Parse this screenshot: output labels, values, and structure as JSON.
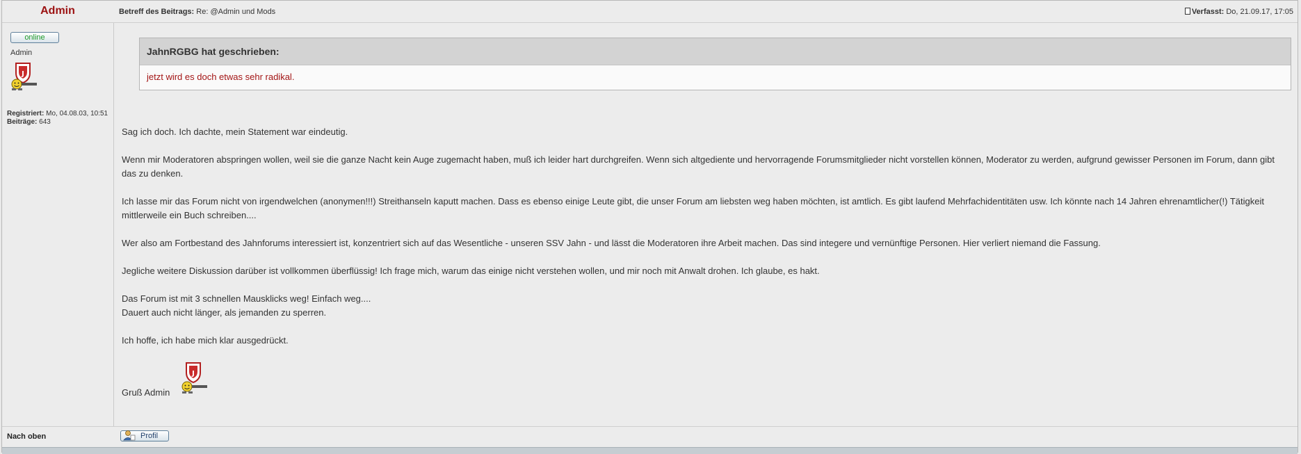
{
  "post": {
    "author": "Admin",
    "subject_label": "Betreff des Beitrags:",
    "subject": "Re: @Admin und Mods",
    "posted_label": "Verfasst:",
    "posted_time": "Do, 21.09.17, 17:05"
  },
  "profile": {
    "status": "online",
    "rank": "Admin",
    "registered_label": "Registriert:",
    "registered_value": "Mo, 04.08.03, 10:51",
    "posts_label": "Beiträge:",
    "posts_value": "643"
  },
  "quote": {
    "header": "JahnRGBG hat geschrieben:",
    "text": "jetzt wird es doch etwas sehr radikal."
  },
  "body": {
    "p1": "Sag ich doch. Ich dachte, mein Statement war eindeutig.",
    "p2": "Wenn mir Moderatoren abspringen wollen, weil sie die ganze Nacht kein Auge zugemacht haben, muß ich leider hart durchgreifen. Wenn sich altgediente und hervorragende Forumsmitglieder nicht vorstellen können, Moderator zu werden, aufgrund gewisser Personen im Forum, dann gibt das zu denken.",
    "p3": "Ich lasse mir das Forum nicht von irgendwelchen (anonymen!!!) Streithanseln kaputt machen. Dass es ebenso einige Leute gibt, die unser Forum am liebsten weg haben möchten, ist amtlich. Es gibt laufend Mehrfachidentitäten usw. Ich könnte nach 14 Jahren ehrenamtlicher(!) Tätigkeit mittlerweile ein Buch schreiben....",
    "p4": "Wer also am Fortbestand des Jahnforums interessiert ist, konzentriert sich auf das Wesentliche - unseren SSV Jahn - und lässt die Moderatoren ihre Arbeit machen. Das sind integere und vernünftige Personen. Hier verliert niemand die Fassung.",
    "p5": "Jegliche weitere Diskussion darüber ist vollkommen überflüssig! Ich frage mich, warum das einige nicht verstehen wollen, und mir noch mit Anwalt drohen. Ich glaube, es hakt.",
    "p6a": "Das Forum ist mit 3 schnellen Mausklicks weg! Einfach weg....",
    "p6b": "Dauert auch nicht länger, als jemanden zu sperren.",
    "p7": "Ich hoffe, ich habe mich klar ausgedrückt.",
    "signature": "Gruß Admin"
  },
  "footer": {
    "top_link": "Nach oben",
    "profile_button": "Profil"
  },
  "colors": {
    "author": "#9b1111",
    "online": "#1f9b2a",
    "quote_text": "#a31515"
  }
}
